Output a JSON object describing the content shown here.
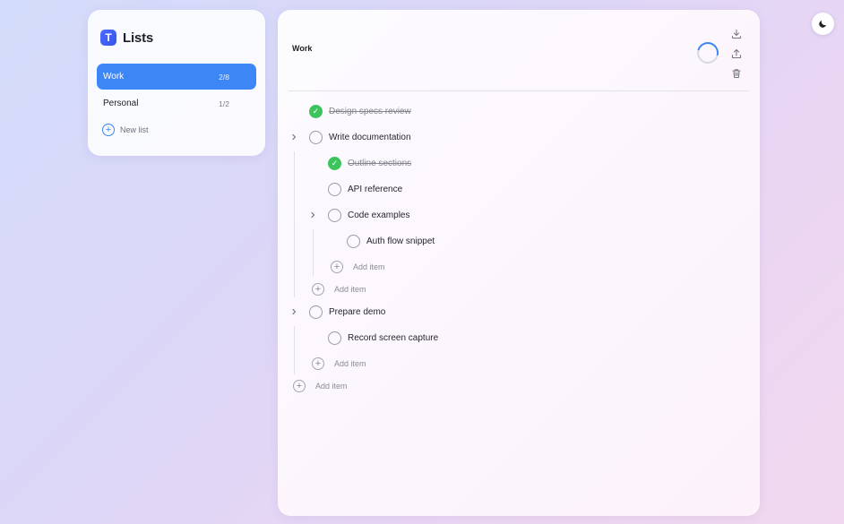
{
  "app": {
    "logo_letter": "T",
    "title": "Lists"
  },
  "sidebar": {
    "lists": [
      {
        "name": "Work",
        "count": "2/8",
        "active": true
      },
      {
        "name": "Personal",
        "count": "1/2",
        "active": false
      }
    ],
    "new_list_label": "New list"
  },
  "main": {
    "title": "Work",
    "tasks": {
      "design_specs": "Design specs review",
      "write_docs": "Write documentation",
      "outline": "Outline sections",
      "api_ref": "API reference",
      "code_examples": "Code examples",
      "auth_flow": "Auth flow snippet",
      "prepare_demo": "Prepare demo",
      "record_screen": "Record screen capture"
    },
    "add_item_label": "Add item"
  },
  "colors": {
    "accent": "#3d86f5",
    "done": "#3dc45c"
  }
}
